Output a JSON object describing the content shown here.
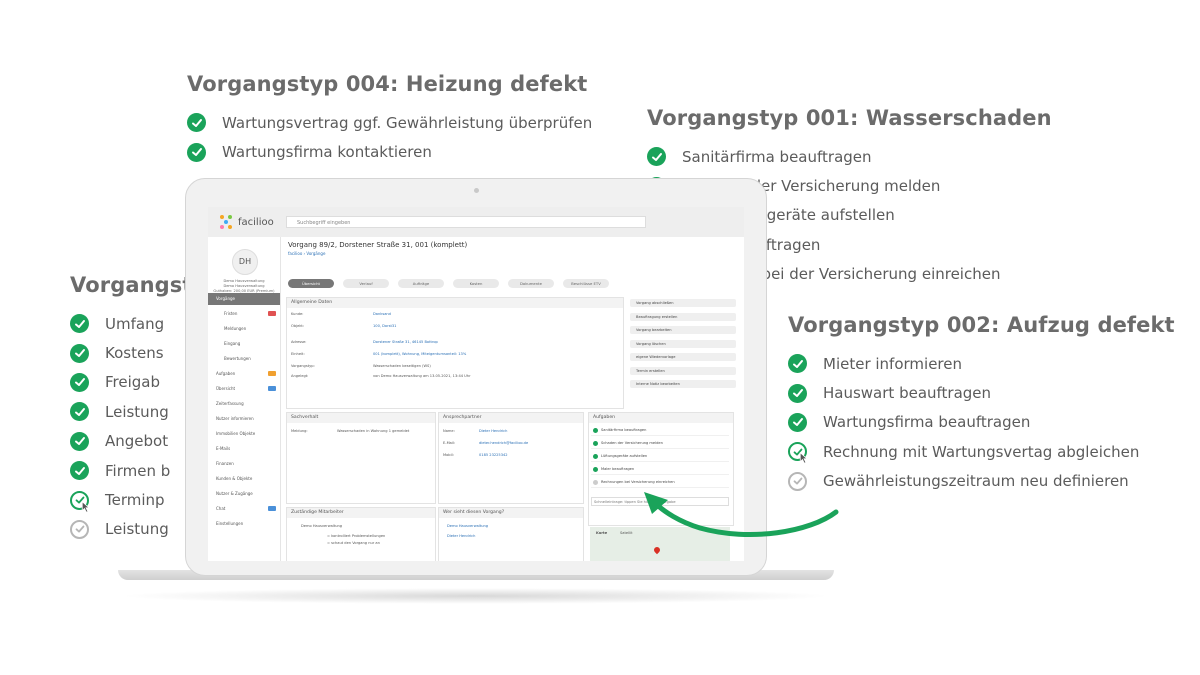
{
  "colors": {
    "done": "#1aa35a",
    "pending": "#b6b6b6",
    "heading": "#6b6b6b",
    "arrow": "#1aa35a"
  },
  "blocks": {
    "b004": {
      "title": "Vorgangstyp 004: Heizung defekt",
      "items": [
        {
          "label": "Wartungsvertrag ggf. Gewährleistung überprüfen",
          "state": "done"
        },
        {
          "label": "Wartungsfirma kontaktieren",
          "state": "done"
        }
      ]
    },
    "b001": {
      "title": "Vorgangstyp 001: Wasserschaden",
      "items": [
        {
          "label": "Sanitärfirma beauftragen",
          "state": "done"
        },
        {
          "label": "Schaden der Versicherung melden",
          "state": "done"
        },
        {
          "label": "Trocknungsgeräte aufstellen",
          "state": "done"
        },
        {
          "label": "Maler beauftragen",
          "state": "cursor"
        },
        {
          "label": "Rechnung bei der Versicherung einreichen",
          "state": "pending"
        }
      ]
    },
    "b003": {
      "title": "Vorgangstyp",
      "items": [
        {
          "label": "Umfang",
          "state": "done"
        },
        {
          "label": "Kostens",
          "state": "done"
        },
        {
          "label": "Freigab",
          "state": "done"
        },
        {
          "label": "Leistung",
          "state": "done"
        },
        {
          "label": "Angebot",
          "state": "done"
        },
        {
          "label": "Firmen b",
          "state": "done"
        },
        {
          "label": "Terminp",
          "state": "cursor"
        },
        {
          "label": "Leistung",
          "state": "pending"
        }
      ]
    },
    "b002": {
      "title": "Vorgangstyp 002: Aufzug defekt",
      "items": [
        {
          "label": "Mieter informieren",
          "state": "done"
        },
        {
          "label": "Hauswart beauftragen",
          "state": "done"
        },
        {
          "label": "Wartungsfirma beauftragen",
          "state": "done"
        },
        {
          "label": "Rechnung mit Wartungsvertag abgleichen",
          "state": "cursor"
        },
        {
          "label": "Gewährleistungszeitraum neu definieren",
          "state": "pending"
        }
      ]
    }
  },
  "app": {
    "logo": "facilioo",
    "search_placeholder": "Suchbegriff eingeben",
    "user": {
      "initials": "DH",
      "name": "Demo Hausverwaltung",
      "sub": "Demo Hausverwaltung",
      "plan": "Guthaben: 200,00 EUR (Premium)"
    },
    "sidebar": [
      {
        "label": "Vorgänge",
        "level": "top",
        "active": true
      },
      {
        "label": "Fristen",
        "level": "sub",
        "badge": "#e05252"
      },
      {
        "label": "Meldungen",
        "level": "sub"
      },
      {
        "label": "Eingang",
        "level": "sub"
      },
      {
        "label": "Bewertungen",
        "level": "sub"
      },
      {
        "label": "Aufgaben",
        "level": "top",
        "badge": "#f0a030"
      },
      {
        "label": "Übersicht",
        "level": "top",
        "badge": "#4a90d9"
      },
      {
        "label": "Zeiterfassung",
        "level": "top"
      },
      {
        "label": "Nutzer informieren",
        "level": "top"
      },
      {
        "label": "Immobilien Objekte",
        "level": "top"
      },
      {
        "label": "E-Mails",
        "level": "top"
      },
      {
        "label": "Finanzen",
        "level": "top"
      },
      {
        "label": "Kunden & Objekte",
        "level": "top"
      },
      {
        "label": "Nutzer & Zugänge",
        "level": "top"
      },
      {
        "label": "Chat",
        "level": "top",
        "badge": "#4a90d9"
      },
      {
        "label": "Einstellungen",
        "level": "top"
      }
    ],
    "title": "Vorgang 89/2, Dorstener Straße 31, 001 (komplett)",
    "breadcrumb": "facilioo  ›  Vorgänge",
    "tabs": [
      "Übersicht",
      "Verlauf",
      "Aufträge",
      "Kosten",
      "Dokumente",
      "Beschlüsse ETV"
    ],
    "general": {
      "header": "Allgemeine Daten",
      "rows": [
        {
          "label": "Kunde:",
          "value": "Danksand"
        },
        {
          "label": "Objekt:",
          "value": "100, Dorst31"
        },
        {
          "label": "Adresse:",
          "value": "Dorstener Straße 31, 46145 Bottrop"
        },
        {
          "label": "Einheit:",
          "value": "001 (komplett), Wohnung, Miteigentumsanteil: 13%"
        },
        {
          "label": "Vorgangstyp:",
          "value": "Wasserschaden beseitigen (WS)"
        },
        {
          "label": "Angelegt:",
          "value": "von Demo Hausverwaltung am 13.05.2021, 13:44 Uhr"
        }
      ]
    },
    "actions": [
      "Vorgang abschließen",
      "Beauftragung erstellen",
      "Vorgang bearbeiten",
      "Vorgang löschen",
      "eigene Wiedervorlage",
      "Termin erstellen",
      "Interne Notiz bearbeiten"
    ],
    "sachverhalt": {
      "header": "Sachverhalt",
      "label": "Meldung:",
      "value": "Wasserschaden in Wohnung 1 gemeldet"
    },
    "contact": {
      "header": "Ansprechpartner",
      "rows": [
        {
          "label": "Name:",
          "value": "Dieter Hendrich"
        },
        {
          "label": "E-Mail:",
          "value": "dieter.hendrich@facilioo.de"
        },
        {
          "label": "Mobil:",
          "value": "0185 23225342"
        }
      ]
    },
    "tasks": {
      "header": "Aufgaben",
      "items": [
        {
          "label": "Sanitärfirma beauftragen",
          "state": "done"
        },
        {
          "label": "Schaden der Versicherung melden",
          "state": "done"
        },
        {
          "label": "Lüftungsgeräte aufstellen",
          "state": "done"
        },
        {
          "label": "Maler beauftragen",
          "state": "done"
        },
        {
          "label": "Rechnungen bei Versicherung einreichen",
          "state": "pending"
        }
      ],
      "input_placeholder": "Schnelleintrage: tippen Sie hier eine Aufgabe"
    },
    "staff": {
      "header": "Zuständige Mitarbeiter",
      "name": "Demo Hausverwaltung",
      "line1": "= kontrolliert Problemstellungen",
      "line2": "= schaut den Vorgang nur an"
    },
    "viewers": {
      "header": "Wer sieht diesen Vorgang?",
      "items": [
        "Demo Hausverwaltung",
        "Dieter Hendrich"
      ]
    },
    "map": {
      "tab1": "Karte",
      "tab2": "Satellit"
    }
  }
}
